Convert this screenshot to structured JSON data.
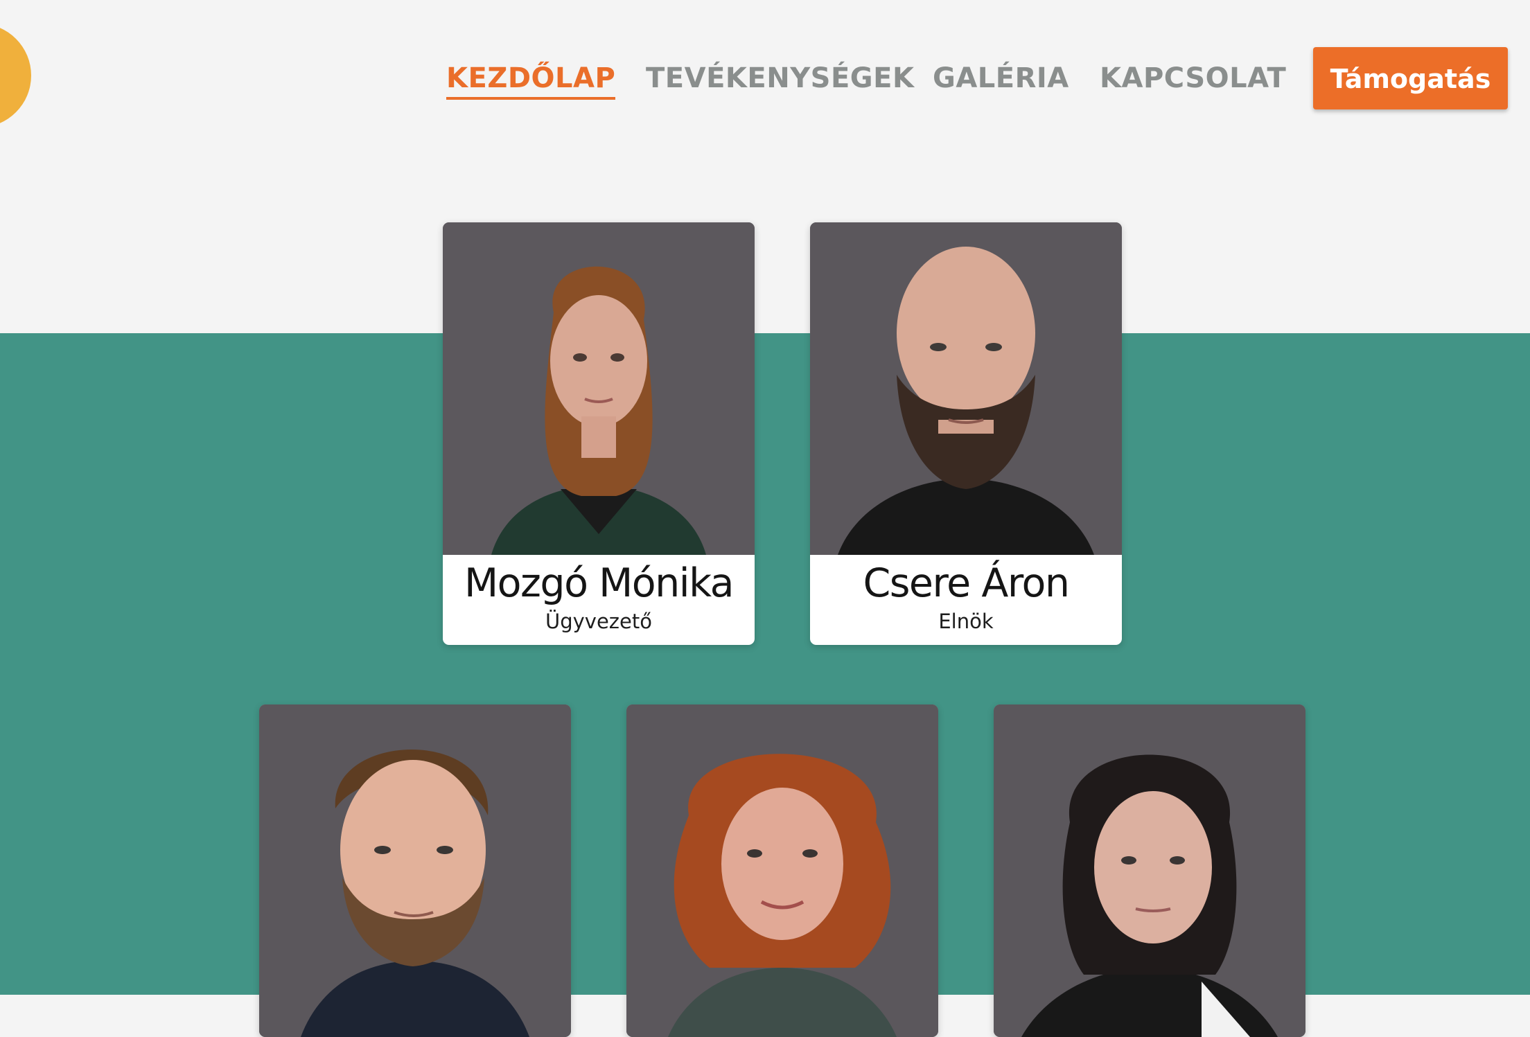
{
  "nav": {
    "items": [
      {
        "label": "KEZDŐLAP",
        "active": true
      },
      {
        "label": "TEVÉKENYSÉGEK",
        "active": false
      },
      {
        "label": "GALÉRIA",
        "active": false
      },
      {
        "label": "KAPCSOLAT",
        "active": false
      }
    ],
    "support_label": "Támogatás"
  },
  "colors": {
    "accent": "#ec6e28",
    "teal": "#429486",
    "nav_inactive": "#8a8e8d",
    "background": "#f4f4f4"
  },
  "team": [
    {
      "name": "Mozgó Mónika",
      "role": "Ügyvezető"
    },
    {
      "name": "Csere Áron",
      "role": "Elnök"
    },
    {
      "name": "",
      "role": ""
    },
    {
      "name": "",
      "role": ""
    },
    {
      "name": "",
      "role": ""
    }
  ]
}
